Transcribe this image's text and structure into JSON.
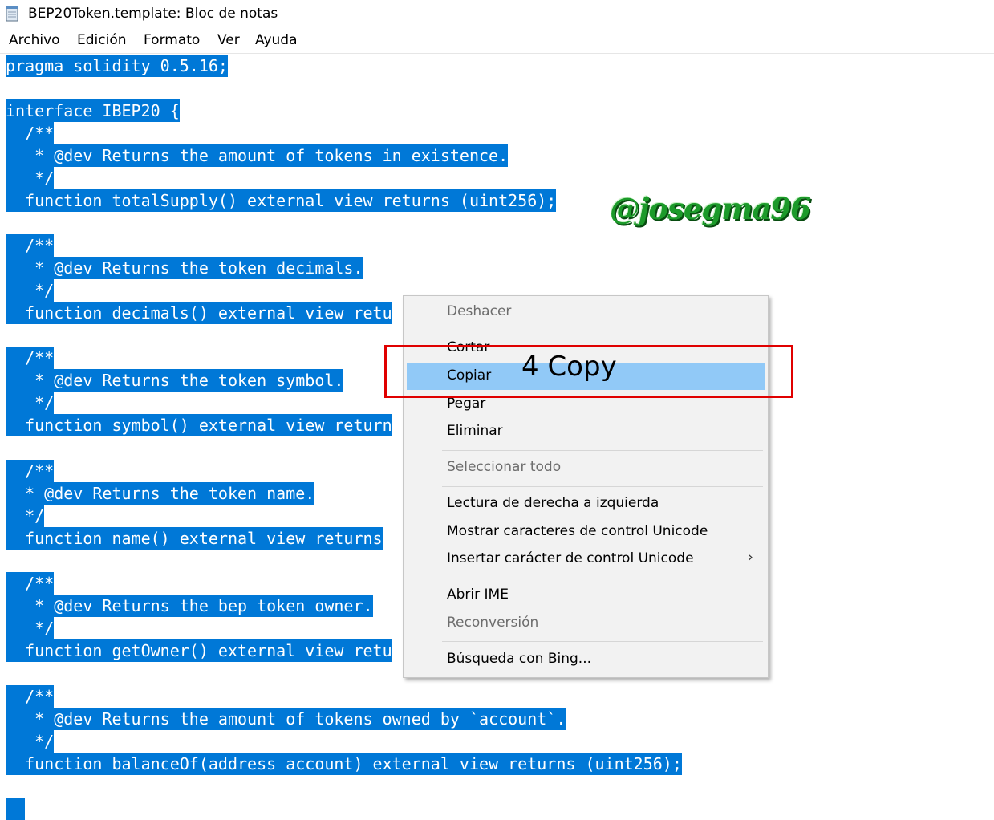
{
  "window": {
    "title": "BEP20Token.template: Bloc de notas",
    "icon": "notepad-icon"
  },
  "menubar": {
    "items": [
      "Archivo",
      "Edición",
      "Formato",
      "Ver",
      "Ayuda"
    ]
  },
  "editor": {
    "selection_color": "#0078d7",
    "lines": [
      "pragma solidity 0.5.16;",
      "interface IBEP20 {",
      "  /**",
      "   * @dev Returns the amount of tokens in existence.",
      "   */",
      "  function totalSupply() external view returns (uint256);",
      "  /**",
      "   * @dev Returns the token decimals.",
      "   */",
      "  function decimals() external view retu",
      "  /**",
      "   * @dev Returns the token symbol.",
      "   */",
      "  function symbol() external view return",
      "  /**",
      "  * @dev Returns the token name.",
      "  */",
      "  function name() external view returns",
      "  /**",
      "   * @dev Returns the bep token owner.",
      "   */",
      "  function getOwner() external view retu",
      "  /**",
      "   * @dev Returns the amount of tokens owned by `account`.",
      "   */",
      "  function balanceOf(address account) external view returns (uint256);",
      "  "
    ]
  },
  "watermark": {
    "text": "@josegma96",
    "color": "#1c9a2a"
  },
  "context_menu": {
    "items": [
      {
        "label": "Deshacer",
        "enabled": false
      },
      {
        "label": "Cortar",
        "enabled": true
      },
      {
        "label": "Copiar",
        "enabled": true,
        "selected": true
      },
      {
        "label": "Pegar",
        "enabled": true
      },
      {
        "label": "Eliminar",
        "enabled": true
      },
      {
        "label": "Seleccionar todo",
        "enabled": false
      },
      {
        "label": "Lectura de derecha a izquierda",
        "enabled": true
      },
      {
        "label": "Mostrar caracteres de control Unicode",
        "enabled": true
      },
      {
        "label": "Insertar carácter de control Unicode",
        "enabled": true,
        "submenu_glyph": "›"
      },
      {
        "label": "Abrir IME",
        "enabled": true
      },
      {
        "label": "Reconversión",
        "enabled": false
      },
      {
        "label": "Búsqueda con Bing...",
        "enabled": true
      }
    ],
    "highlight_color": "#91c9f7"
  },
  "annotation": {
    "label": "4 Copy",
    "box_color": "#e00000"
  }
}
